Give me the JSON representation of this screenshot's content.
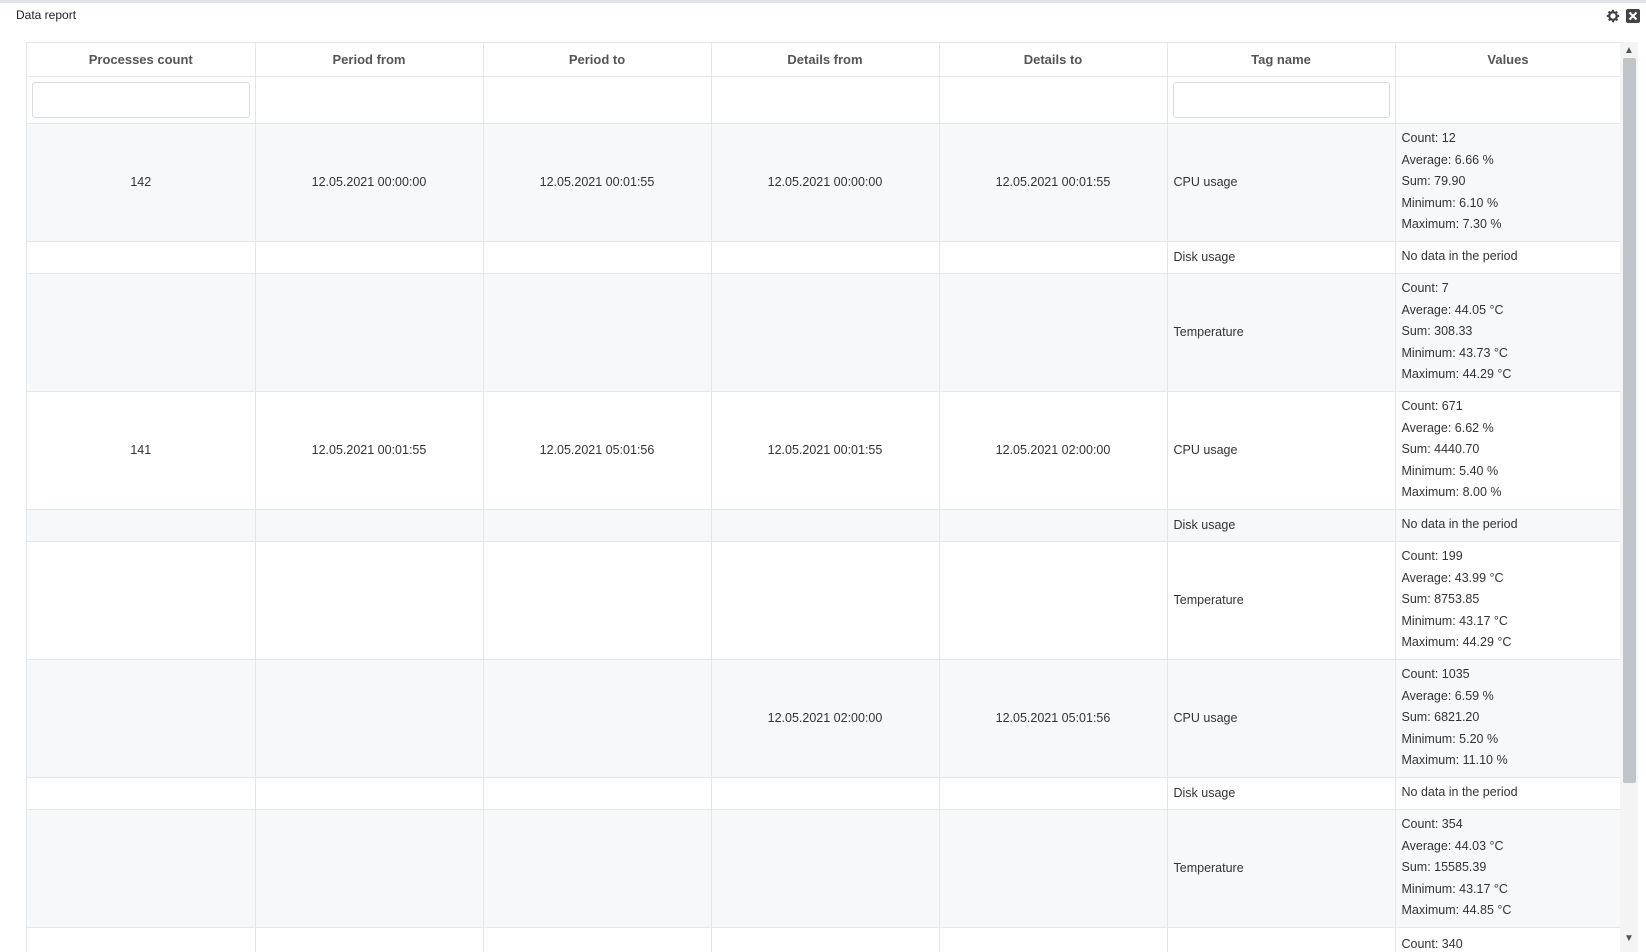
{
  "panel": {
    "title": "Data report"
  },
  "columns": [
    "Processes count",
    "Period from",
    "Period to",
    "Details from",
    "Details to",
    "Tag name",
    "Values"
  ],
  "filters": {
    "processes_value": "",
    "tag_value": ""
  },
  "rows": [
    {
      "process": "142",
      "period_from": "12.05.2021 00:00:00",
      "period_to": "12.05.2021 00:01:55",
      "details_from": "12.05.2021 00:00:00",
      "details_to": "12.05.2021 00:01:55",
      "tag": "CPU usage",
      "values": [
        "Count: 12",
        "Average: 6.66 %",
        "Sum: 79.90",
        "Minimum: 6.10 %",
        "Maximum: 7.30 %"
      ]
    },
    {
      "process": "",
      "period_from": "",
      "period_to": "",
      "details_from": "",
      "details_to": "",
      "tag": "Disk usage",
      "values": [
        "No data in the period"
      ]
    },
    {
      "process": "",
      "period_from": "",
      "period_to": "",
      "details_from": "",
      "details_to": "",
      "tag": "Temperature",
      "values": [
        "Count: 7",
        "Average: 44.05 °C",
        "Sum: 308.33",
        "Minimum: 43.73 °C",
        "Maximum: 44.29 °C"
      ]
    },
    {
      "process": "141",
      "period_from": "12.05.2021 00:01:55",
      "period_to": "12.05.2021 05:01:56",
      "details_from": "12.05.2021 00:01:55",
      "details_to": "12.05.2021 02:00:00",
      "tag": "CPU usage",
      "values": [
        "Count: 671",
        "Average: 6.62 %",
        "Sum: 4440.70",
        "Minimum: 5.40 %",
        "Maximum: 8.00 %"
      ]
    },
    {
      "process": "",
      "period_from": "",
      "period_to": "",
      "details_from": "",
      "details_to": "",
      "tag": "Disk usage",
      "values": [
        "No data in the period"
      ]
    },
    {
      "process": "",
      "period_from": "",
      "period_to": "",
      "details_from": "",
      "details_to": "",
      "tag": "Temperature",
      "values": [
        "Count: 199",
        "Average: 43.99 °C",
        "Sum: 8753.85",
        "Minimum: 43.17 °C",
        "Maximum: 44.29 °C"
      ]
    },
    {
      "process": "",
      "period_from": "",
      "period_to": "",
      "details_from": "12.05.2021 02:00:00",
      "details_to": "12.05.2021 05:01:56",
      "tag": "CPU usage",
      "values": [
        "Count: 1035",
        "Average: 6.59 %",
        "Sum: 6821.20",
        "Minimum: 5.20 %",
        "Maximum: 11.10 %"
      ]
    },
    {
      "process": "",
      "period_from": "",
      "period_to": "",
      "details_from": "",
      "details_to": "",
      "tag": "Disk usage",
      "values": [
        "No data in the period"
      ]
    },
    {
      "process": "",
      "period_from": "",
      "period_to": "",
      "details_from": "",
      "details_to": "",
      "tag": "Temperature",
      "values": [
        "Count: 354",
        "Average: 44.03 °C",
        "Sum: 15585.39",
        "Minimum: 43.17 °C",
        "Maximum: 44.85 °C"
      ]
    },
    {
      "process": "",
      "period_from": "",
      "period_to": "",
      "details_from": "",
      "details_to": "",
      "tag": "",
      "values": [
        "Count: 340"
      ]
    }
  ],
  "icons": {
    "settings": "gear-icon",
    "close": "close-icon",
    "scroll_up": "chevron-up-icon",
    "scroll_down": "chevron-down-icon"
  }
}
